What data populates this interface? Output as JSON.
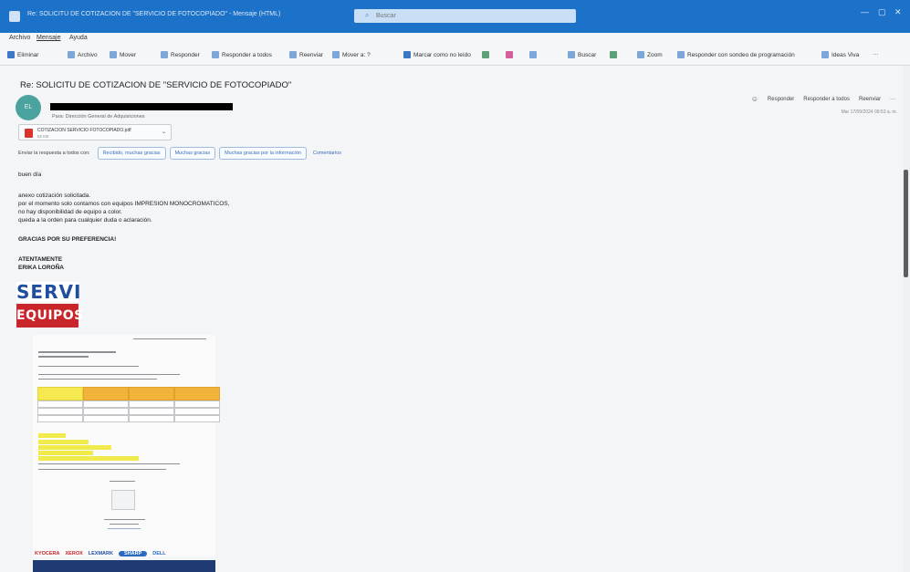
{
  "window": {
    "title": "Re: SOLICITU DE COTIZACION DE \"SERVICIO DE FOTOCOPIADO\" - Mensaje (HTML)",
    "search_placeholder": "Buscar"
  },
  "menu": {
    "items": [
      "Archivo",
      "Mensaje",
      "Ayuda"
    ]
  },
  "ribbon": {
    "eliminar": "Eliminar",
    "archivo": "Archivo",
    "mover": "Mover",
    "responder": "Responder",
    "responder_todos": "Responder a todos",
    "reenviar": "Reenviar",
    "mover_a": "Mover a: ?",
    "marcar": "Marcar como no leído",
    "buscar": "Buscar",
    "zoom": "Zoom",
    "responder_sondeo": "Responder con sondeo de programación",
    "ideas": "Ideas Viva",
    "more": "···"
  },
  "message": {
    "subject": "Re: SOLICITU DE COTIZACION DE \"SERVICIO DE FOTOCOPIADO\"",
    "avatar": "EL",
    "to": "Para: Dirección General de Adquisiciones",
    "date": "Mar 17/09/2024 09:53 a. m.",
    "actions": {
      "reply": "Responder",
      "reply_all": "Responder a todos",
      "forward": "Reenviar",
      "more": "···"
    },
    "attachment": {
      "name": "COTIZACION SERVICIO FOTOCOPIADO.pdf",
      "size": "52 KB"
    },
    "quick_reply": {
      "label": "Enviar la respuesta a todos con:",
      "chips": [
        "Recibido, muchas gracias",
        "Muchas gracias",
        "Muchas gracias por la información"
      ],
      "comments": "Comentarios"
    },
    "body": {
      "greeting": "buen día",
      "lines": [
        "anexo cotización solicitada.",
        "por el momento solo contamos con equipos IMPRESION MONOCROMATICOS,",
        "no hay disponibilidad de equipo a color.",
        "queda a la orden para cualquier duda o aclaración."
      ],
      "thanks": "GRACIAS POR SU PREFERENCIA!",
      "closing": "ATENTAMENTE",
      "signature": "ERIKA LOROÑA"
    },
    "logo": {
      "top": "SERVI",
      "bottom": "EQUIPOS"
    },
    "brands": [
      "KYOCERA",
      "XEROX",
      "LEXMARK",
      "SHARP",
      "DELL"
    ]
  },
  "colors": {
    "titlebar": "#1c71c8",
    "logo_blue": "#1f4e9e",
    "logo_red": "#c8262a",
    "table_header": "#f2b33a",
    "highlight": "#f0ea4b",
    "footer": "#203a74"
  }
}
